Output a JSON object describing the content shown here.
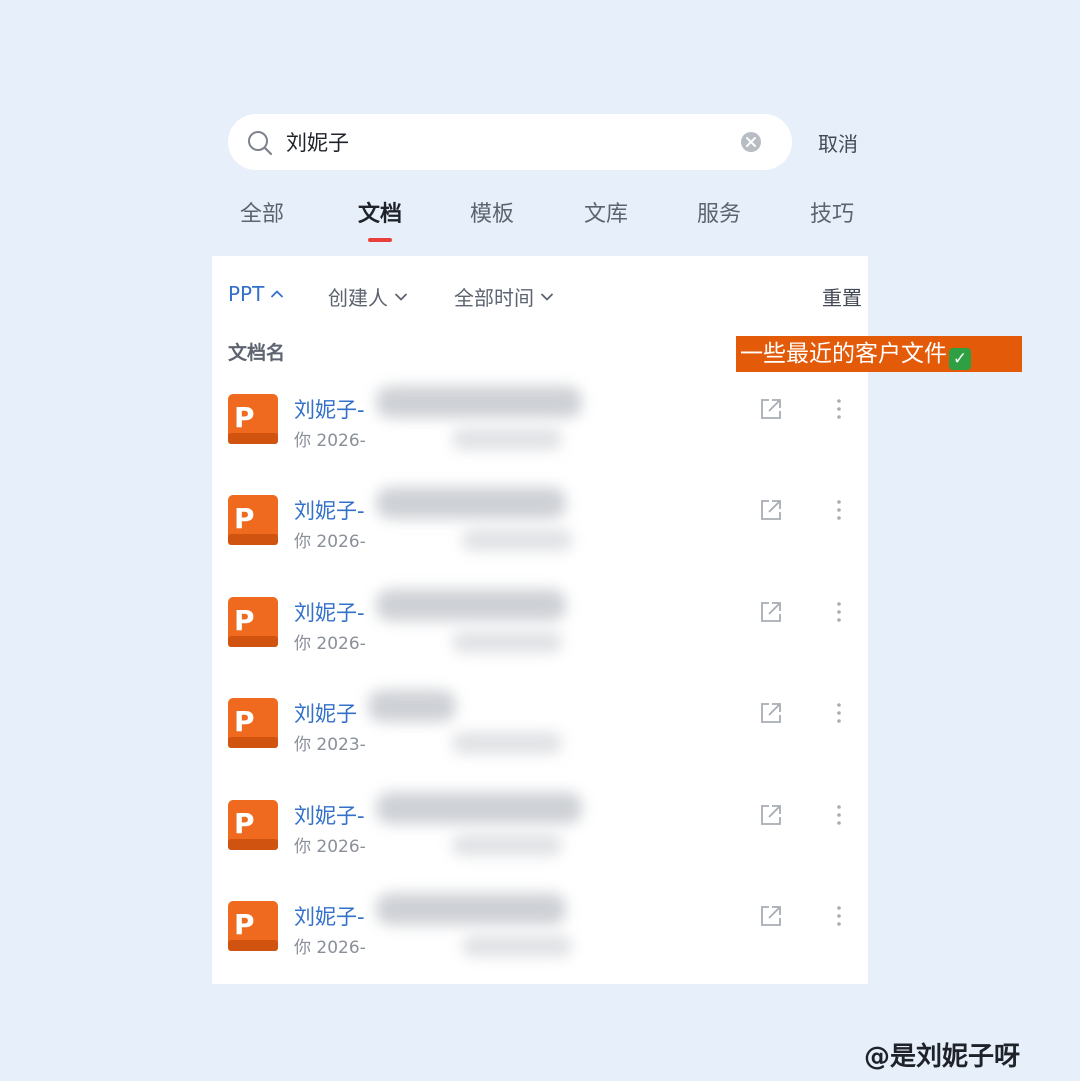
{
  "search": {
    "value": "刘妮子",
    "cancel_label": "取消"
  },
  "tabs": [
    {
      "label": "全部",
      "active": false
    },
    {
      "label": "文档",
      "active": true
    },
    {
      "label": "模板",
      "active": false
    },
    {
      "label": "文库",
      "active": false
    },
    {
      "label": "服务",
      "active": false
    },
    {
      "label": "技巧",
      "active": false
    }
  ],
  "filters": {
    "type_label": "PPT",
    "creator_label": "创建人",
    "time_label": "全部时间",
    "reset_label": "重置"
  },
  "list": {
    "column_header": "文档名",
    "files": [
      {
        "name": "刘妮子-",
        "meta": "你 2026-",
        "icon": "ppt-icon"
      },
      {
        "name": "刘妮子-",
        "meta": "你 2026-",
        "icon": "ppt-icon"
      },
      {
        "name": "刘妮子-",
        "meta": "你 2026-",
        "icon": "ppt-icon"
      },
      {
        "name": "刘妮子",
        "meta": "你 2023-",
        "icon": "ppt-icon"
      },
      {
        "name": "刘妮子-",
        "meta": "你 2026-",
        "icon": "ppt-icon"
      },
      {
        "name": "刘妮子-",
        "meta": "你 2026-",
        "icon": "ppt-icon"
      }
    ]
  },
  "annotation": {
    "text": "一些最近的客户文件",
    "icon": "check-mark-icon"
  },
  "watermark": {
    "text": "@是刘妮子呀"
  },
  "colors": {
    "accent": "#3370c9",
    "tab_indicator": "#e8413c",
    "annotation_bg": "#e35a09",
    "ppt_icon": "#ef6a1f",
    "page_bg": "#e7f0fa"
  }
}
